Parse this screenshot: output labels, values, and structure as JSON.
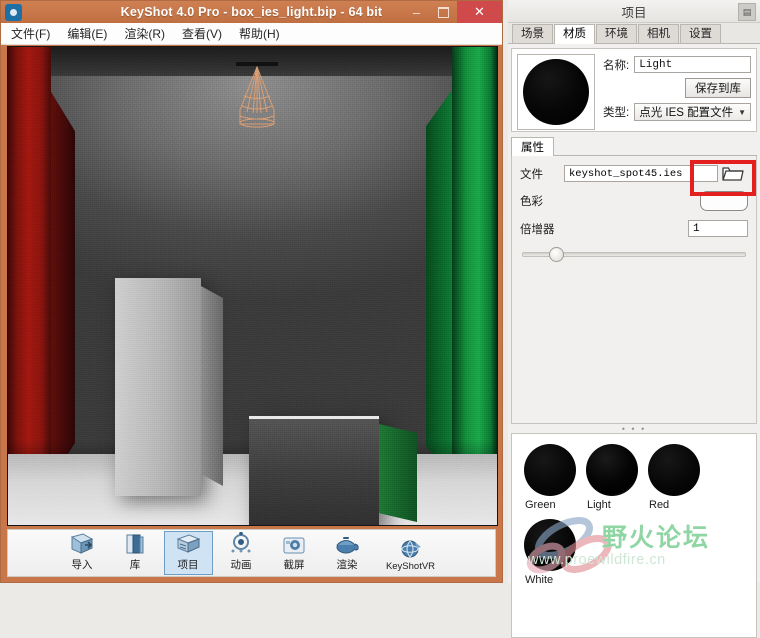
{
  "window": {
    "title": "KeyShot 4.0 Pro  - box_ies_light.bip  - 64 bit",
    "icon": "keyshot-app-icon",
    "minimize": "–",
    "maximize": "maximize-icon",
    "close": "✕"
  },
  "menubar": {
    "items": [
      {
        "label": "文件(F)"
      },
      {
        "label": "编辑(E)"
      },
      {
        "label": "渲染(R)"
      },
      {
        "label": "查看(V)"
      },
      {
        "label": "帮助(H)"
      }
    ]
  },
  "toolbar": {
    "items": [
      {
        "label": "导入",
        "icon": "import-icon",
        "active": false
      },
      {
        "label": "库",
        "icon": "library-icon",
        "active": false
      },
      {
        "label": "项目",
        "icon": "project-icon",
        "active": true
      },
      {
        "label": "动画",
        "icon": "animation-icon",
        "active": false
      },
      {
        "label": "截屏",
        "icon": "screenshot-icon",
        "active": false
      },
      {
        "label": "渲染",
        "icon": "render-icon",
        "active": false
      },
      {
        "label": "KeyShotVR",
        "icon": "keyshotvr-icon",
        "active": false
      }
    ]
  },
  "panel": {
    "title": "项目",
    "pin_icon": "pin-icon",
    "tabs": [
      {
        "label": "场景",
        "active": false
      },
      {
        "label": "材质",
        "active": true
      },
      {
        "label": "环境",
        "active": false
      },
      {
        "label": "相机",
        "active": false
      },
      {
        "label": "设置",
        "active": false
      }
    ],
    "material": {
      "preview_icon": "material-preview-sphere",
      "name_label": "名称:",
      "name_value": "Light",
      "save_label": "保存到库",
      "type_label": "类型:",
      "type_value": "点光 IES 配置文件",
      "type_caret": "▼"
    },
    "properties": {
      "tab_label": "属性",
      "file_label": "文件",
      "file_value": "keyshot_spot45.ies",
      "folder_icon": "folder-open-icon",
      "highlight_color": "#e41f1f",
      "color_label": "色彩",
      "color_value": "#ffffff",
      "multiplier_label": "倍增器",
      "multiplier_value": "1",
      "slider_position": "12"
    },
    "library": {
      "grip_icon": "drag-grip-icon",
      "materials": [
        {
          "name": "Green",
          "swatch": "#000000"
        },
        {
          "name": "Light",
          "swatch": "#000000"
        },
        {
          "name": "Red",
          "swatch": "#000000"
        },
        {
          "name": "White",
          "swatch": "#000000"
        }
      ]
    }
  },
  "viewport": {
    "name": "render-viewport",
    "scene_icon": "cornell-box-render",
    "lamp_icon": "ies-lamp-cage-icon"
  },
  "watermark": {
    "logo_icon": "forum-ribbon-logo",
    "text_cn": "野火论坛",
    "url": "www.proewildfire.cn"
  }
}
